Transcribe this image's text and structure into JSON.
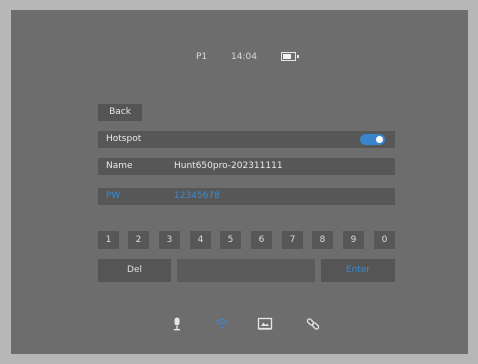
{
  "status": {
    "profile": "P1",
    "time": "14:04",
    "battery_icon": "battery-icon"
  },
  "back_label": "Back",
  "hotspot": {
    "label": "Hotspot",
    "enabled": true
  },
  "name": {
    "label": "Name",
    "value": "Hunt650pro-202311111"
  },
  "pw": {
    "label": "PW",
    "value": "12345678"
  },
  "keypad": {
    "keys": [
      "1",
      "2",
      "3",
      "4",
      "5",
      "6",
      "7",
      "8",
      "9",
      "0"
    ],
    "del_label": "Del",
    "enter_label": "Enter"
  },
  "bottom_icons": [
    "microphone-icon",
    "wifi-icon",
    "screen-icon",
    "link-icon"
  ],
  "colors": {
    "accent": "#3a86cc",
    "screen_bg": "#6d6d6d",
    "row_bg": "#575757"
  }
}
